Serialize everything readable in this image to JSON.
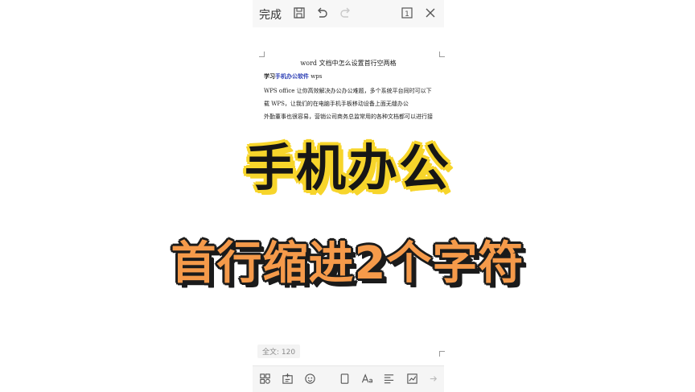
{
  "topbar": {
    "done_label": "完成",
    "page_badge": "1",
    "icons": [
      "save-icon",
      "undo-icon",
      "redo-icon",
      "page-view-icon",
      "close-icon"
    ]
  },
  "document": {
    "title": "word 文档中怎么设置首行空两格",
    "line1_prefix": "学习",
    "line1_link": "手机办公软件",
    "line1_suffix": " wps",
    "line2": "WPS office 让你高效解决办公办公难题，多个系统平台同时可以下",
    "line3": "载 WPS，让我们的在电脑手机手板移动设备上面无缝办公",
    "line4": "外勤董事也很容易，营销公司商务总监常用的各种文档都可以进行接"
  },
  "status": {
    "word_count": "全文: 120"
  },
  "bottombar": {
    "icons": [
      "apps-grid-icon",
      "insert-icon",
      "emoji-icon",
      "page-icon",
      "font-icon",
      "paragraph-icon",
      "chart-icon",
      "more-icon"
    ]
  },
  "overlay": {
    "headline": "手机办公",
    "subheadline": "首行缩进2个字符"
  },
  "colors": {
    "headline_outline": "#f7d52b",
    "subheadline_fill": "#f59a4a",
    "link": "#2d3fb5"
  }
}
